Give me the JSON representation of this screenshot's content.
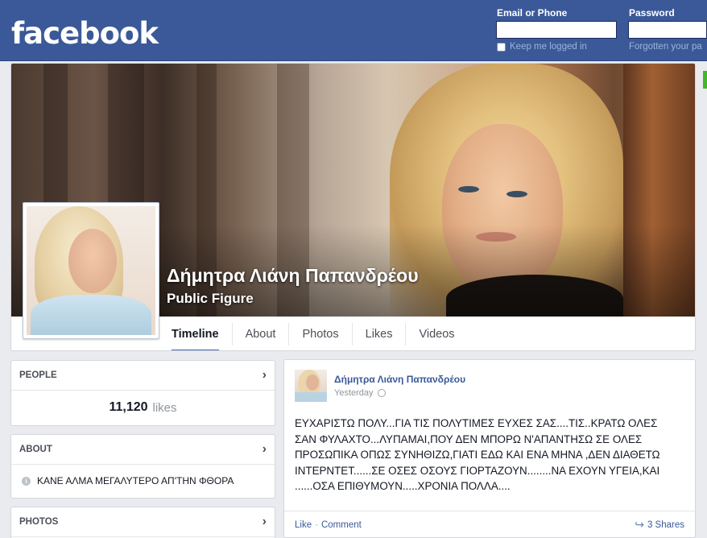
{
  "header": {
    "logo": "facebook",
    "email_label": "Email or Phone",
    "password_label": "Password",
    "keep_logged_in": "Keep me logged in",
    "forgot": "Forgotten your pa"
  },
  "page": {
    "name": "Δήμητρα Λιάνη Παπανδρέου",
    "category": "Public Figure"
  },
  "tabs": [
    {
      "label": "Timeline",
      "active": true
    },
    {
      "label": "About",
      "active": false
    },
    {
      "label": "Photos",
      "active": false
    },
    {
      "label": "Likes",
      "active": false
    },
    {
      "label": "Videos",
      "active": false
    }
  ],
  "sidebar": {
    "people": {
      "title": "PEOPLE",
      "likes_count": "11,120",
      "likes_word": "likes"
    },
    "about": {
      "title": "ABOUT",
      "text": "ΚΑΝΕ ΑΛΜΑ ΜΕΓΑΛΥΤΕΡΟ ΑΠ'ΤΗΝ ΦΘΟΡΑ"
    },
    "photos": {
      "title": "PHOTOS"
    }
  },
  "post": {
    "author": "Δήμητρα Λιάνη Παπανδρέου",
    "time": "Yesterday",
    "lines": [
      "ΕΥΧΑΡΙΣΤΩ ΠΟΛΥ...ΓΙΑ ΤΙΣ ΠΟΛΥΤΙΜΕΣ ΕΥΧΕΣ ΣΑΣ....ΤΙΣ..ΚΡΑΤΩ ΟΛΕΣ",
      "ΣΑΝ ΦΥΛΑΧΤΟ...ΛΥΠΑΜΑΙ,ΠΟΥ ΔΕΝ ΜΠΟΡΩ Ν'ΑΠΑΝΤΗΣΩ ΣΕ ΟΛΕΣ",
      "ΠΡΟΣΩΠΙΚΑ ΟΠΩΣ ΣΥΝΗΘΙΖΩ,ΓΙΑΤΙ ΕΔΩ ΚΑΙ ΕΝΑ ΜΗΝΑ ,ΔΕΝ ΔΙΑΘΕΤΩ",
      "ΙΝΤΕΡΝΤΕΤ......ΣΕ ΟΣΕΣ ΟΣΟΥΣ ΓΙΟΡΤΑΖΟΥΝ........ΝΑ ΕΧΟΥΝ ΥΓΕΙΑ,ΚΑΙ",
      "......ΟΣΑ ΕΠΙΘΥΜΟΥΝ.....ΧΡΟΝΙΑ ΠΟΛΛΑ...."
    ],
    "like": "Like",
    "separator": "·",
    "comment": "Comment",
    "shares": "3 Shares"
  },
  "colors": {
    "brand": "#3b5998",
    "background": "#e9ebee",
    "active_tab": "#4267b2"
  },
  "icons": {
    "chevron": "chevron-right-icon",
    "about_info": "info-icon",
    "privacy": "globe-icon",
    "share": "share-icon"
  }
}
